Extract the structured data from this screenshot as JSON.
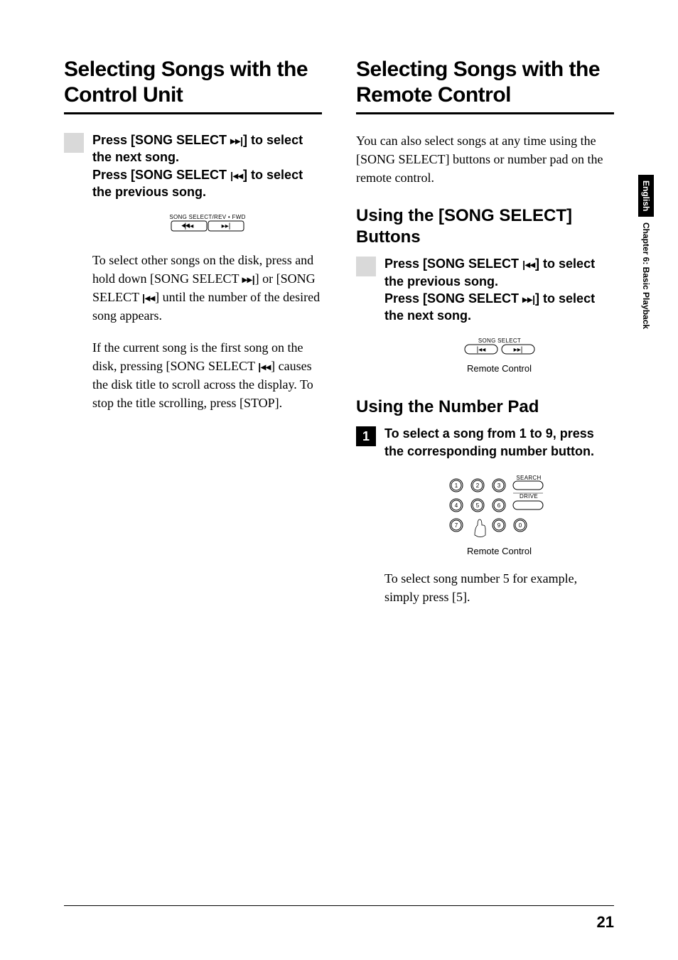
{
  "sidebar": {
    "language": "English",
    "chapter": "Chapter 6:  Basic Playback"
  },
  "page_number": "21",
  "left": {
    "heading": "Selecting Songs with the Control Unit",
    "step1": {
      "line1a": "Press [SONG SELECT ",
      "line1b": "] to select the next song.",
      "line2a": "Press [SONG SELECT ",
      "line2b": "] to select the previous song."
    },
    "svg_label": "SONG SELECT/REV • FWD",
    "para1a": "To select other songs on the disk, press and hold down [SONG SELECT ",
    "para1b": "] or [SONG SELECT ",
    "para1c": "] until the number of the desired song appears.",
    "para2a": "If the current song is the first song on the disk, pressing [SONG SELECT ",
    "para2b": "] causes the disk title to scroll across the display. To stop the title scrolling, press [STOP]."
  },
  "right": {
    "heading": "Selecting Songs with the Remote Control",
    "intro": "You can also select songs at any time using the [SONG SELECT] buttons or number pad on the remote control.",
    "sub1": "Using the [SONG SELECT] Buttons",
    "step1": {
      "line1a": "Press [SONG SELECT ",
      "line1b": "] to select the previous song.",
      "line2a": "Press [SONG SELECT ",
      "line2b": "] to select the next song."
    },
    "svg_label": "SONG SELECT",
    "caption1": "Remote Control",
    "sub2": "Using the Number Pad",
    "step2_num": "1",
    "step2_text": "To select a song from 1 to 9, press the corresponding number button.",
    "numpad": {
      "search": "SEARCH",
      "drive": "DRIVE",
      "caption": "Remote Control"
    },
    "para_end": "To select song number 5 for example, simply press [5]."
  }
}
